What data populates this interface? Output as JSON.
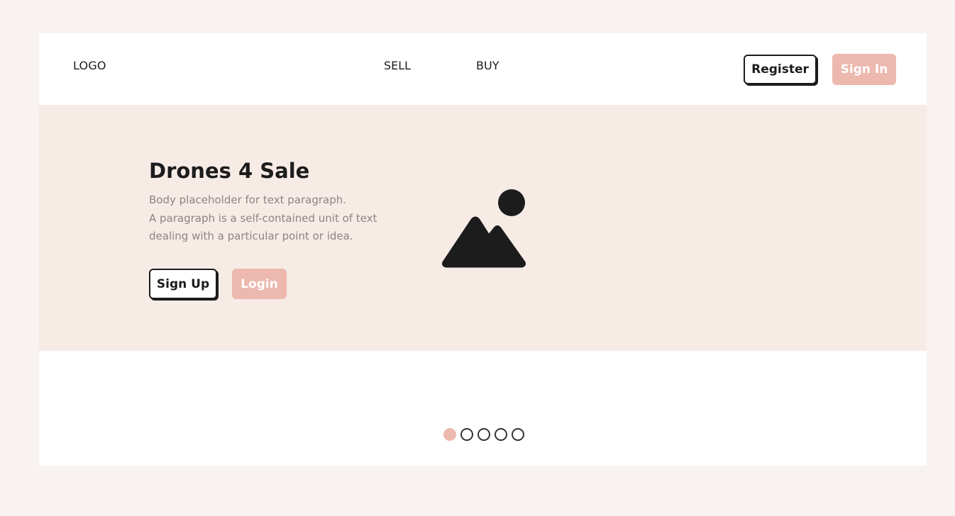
{
  "header": {
    "logo": "LOGO",
    "nav": {
      "sell": "SELL",
      "buy": "BUY"
    },
    "register_label": "Register",
    "signin_label": "Sign In"
  },
  "hero": {
    "title": "Drones 4 Sale",
    "body_lines": [
      "Body placeholder for text paragraph.",
      "A paragraph is a self-contained unit of text",
      "dealing with a particular point or idea."
    ],
    "signup_label": "Sign Up",
    "login_label": "Login",
    "image_icon": "image-placeholder-icon"
  },
  "carousel": {
    "slide_count": 5,
    "active_index": 0
  },
  "colors": {
    "page_background": "#f8f3f0",
    "hero_background": "#f7ebe6",
    "accent": "#edb8ae",
    "text_dark": "#1c1c1c",
    "text_muted": "#8a8584"
  }
}
